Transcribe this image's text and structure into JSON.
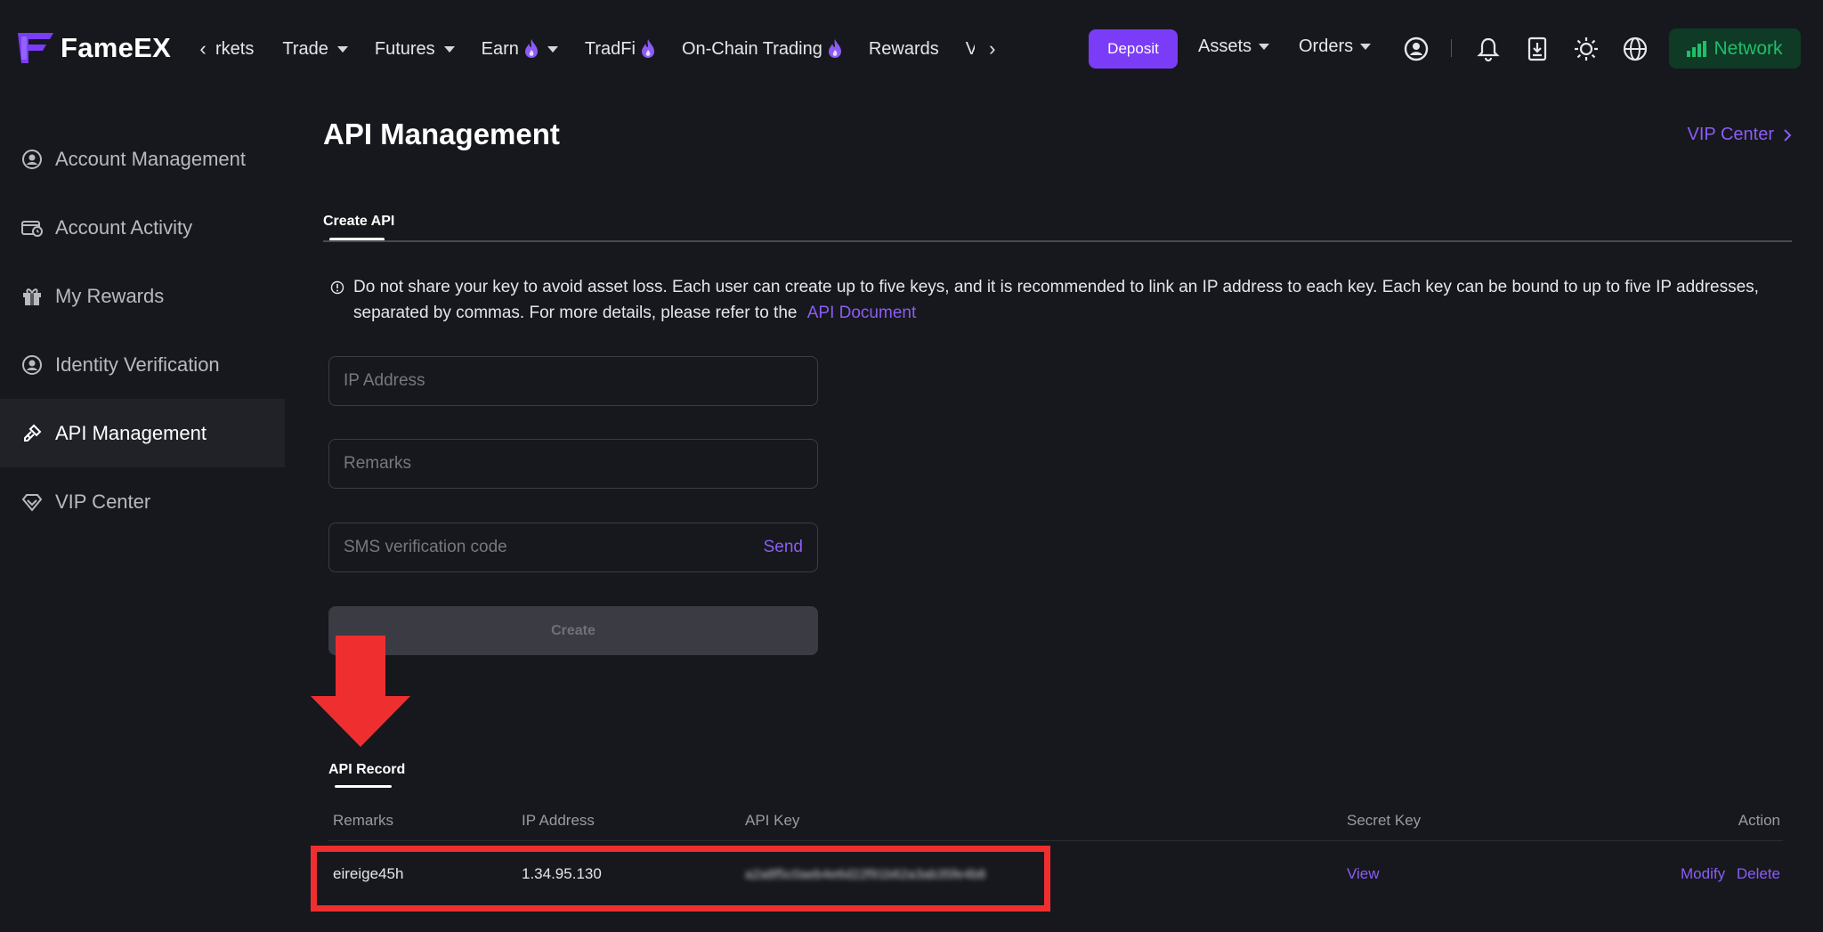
{
  "brand": {
    "name": "FameEX"
  },
  "nav": {
    "items": [
      {
        "label": "rkets",
        "caret": false,
        "fire": false
      },
      {
        "label": "Trade",
        "caret": true,
        "fire": false
      },
      {
        "label": "Futures",
        "caret": true,
        "fire": false
      },
      {
        "label": "Earn",
        "caret": true,
        "fire": true
      },
      {
        "label": "TradFi",
        "caret": false,
        "fire": true
      },
      {
        "label": "On-Chain Trading",
        "caret": false,
        "fire": true
      },
      {
        "label": "Rewards",
        "caret": false,
        "fire": false
      },
      {
        "label": "V",
        "caret": false,
        "fire": false
      }
    ],
    "deposit_label": "Deposit",
    "assets_label": "Assets",
    "orders_label": "Orders",
    "network_label": "Network"
  },
  "sidebar": {
    "items": [
      {
        "label": "Account Management",
        "icon": "user-circle-icon"
      },
      {
        "label": "Account Activity",
        "icon": "wallet-clock-icon"
      },
      {
        "label": "My Rewards",
        "icon": "gift-icon"
      },
      {
        "label": "Identity Verification",
        "icon": "id-user-icon"
      },
      {
        "label": "API Management",
        "icon": "key-icon",
        "active": true
      },
      {
        "label": "VIP Center",
        "icon": "diamond-icon"
      }
    ]
  },
  "page": {
    "title": "API Management",
    "vip_link": "VIP Center",
    "tab": "Create API",
    "notice": "Do not share your key to avoid asset loss. Each user can create up to five keys, and it is recommended to link an IP address to each key. Each key can be bound to up to five IP addresses, separated by commas. For more details, please refer to the",
    "notice_link": "API Document"
  },
  "form": {
    "ip_placeholder": "IP Address",
    "remarks_placeholder": "Remarks",
    "sms_placeholder": "SMS verification code",
    "send_label": "Send",
    "create_label": "Create"
  },
  "record": {
    "title": "API Record",
    "headers": {
      "remarks": "Remarks",
      "ip": "IP Address",
      "api_key": "API Key",
      "secret": "Secret Key",
      "action": "Action"
    },
    "rows": [
      {
        "remarks": "eireige45h",
        "ip": "1.34.95.130",
        "api_key": "a2a8f5c0aeb4e6d22f91b62a3ab35fe4b8",
        "secret": "View",
        "modify": "Modify",
        "delete": "Delete"
      }
    ]
  },
  "colors": {
    "accent": "#7b3cf7",
    "link": "#8b5cf6",
    "background": "#17181d",
    "network_green": "#1fbf6b",
    "highlight_red": "#ef2f2f"
  }
}
